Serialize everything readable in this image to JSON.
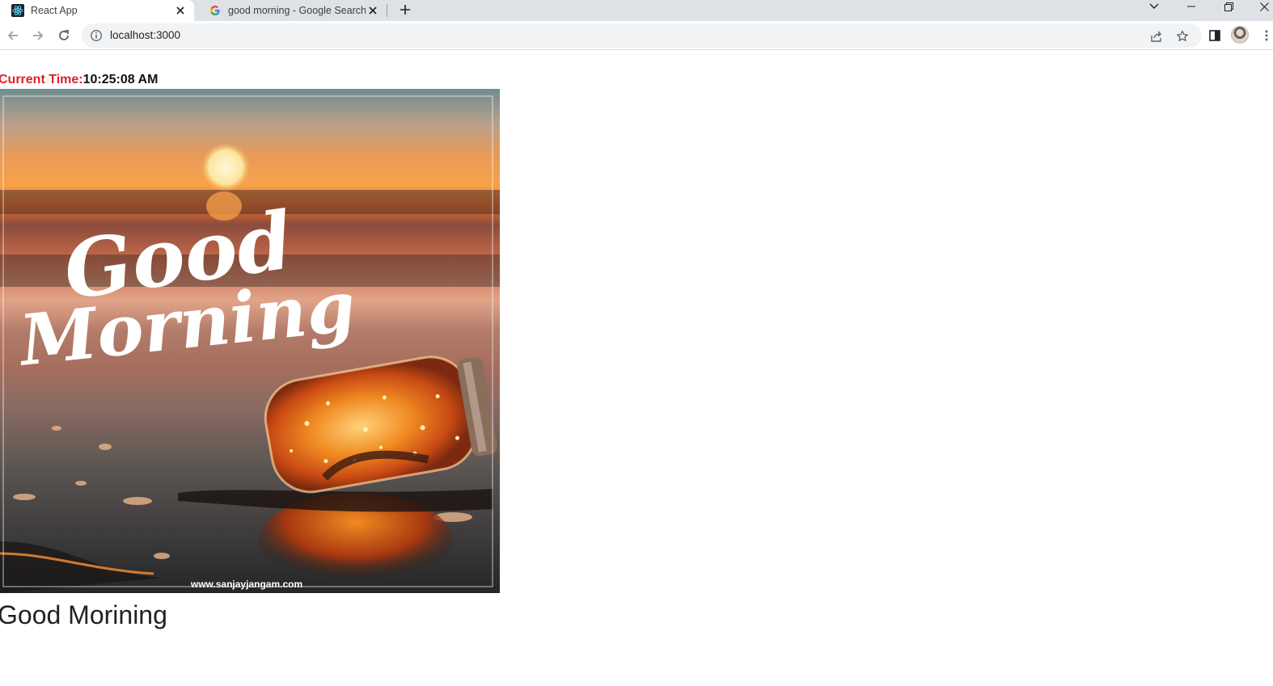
{
  "browser": {
    "tabs": [
      {
        "title": "React App",
        "active": true,
        "favicon": "react-icon"
      },
      {
        "title": "good morning - Google Search",
        "active": false,
        "favicon": "google-icon"
      }
    ],
    "address_bar": {
      "url": "localhost:3000"
    }
  },
  "page": {
    "time_label": "Current Time:",
    "time_value": "10:25:08 AM",
    "image": {
      "overlay_text_line1": "Good",
      "overlay_text_line2": "Morning",
      "watermark": "www.sanjayjangam.com"
    },
    "heading": "Good Morining"
  },
  "colors": {
    "time_label": "#e0202a",
    "tabstrip": "#dee1e6",
    "omnibox": "#f1f3f4"
  }
}
